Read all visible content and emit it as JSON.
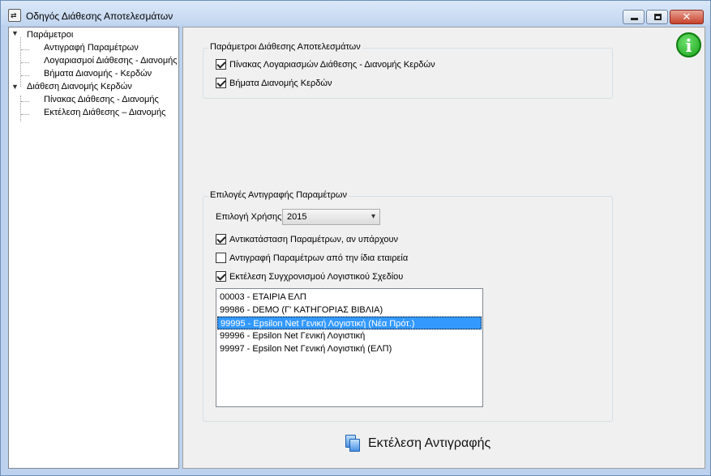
{
  "window": {
    "title": "Οδηγός Διάθεσης Αποτελεσμάτων",
    "app_icon": "arrows-icon"
  },
  "tree": {
    "nodes": [
      {
        "label": "Παράμετροι",
        "level": 0,
        "expanded": true
      },
      {
        "label": "Αντιγραφή Παραμέτρων",
        "level": 1
      },
      {
        "label": "Λογαριασμοί Διάθεσης - Διανομής",
        "level": 1
      },
      {
        "label": "Βήματα Διανομής - Κερδών",
        "level": 1
      },
      {
        "label": "Διάθεση Διανομής Κερδών",
        "level": 0,
        "expanded": true
      },
      {
        "label": "Πίνακας Διάθεσης - Διανομής",
        "level": 1
      },
      {
        "label": "Εκτέλεση Διάθεσης – Διανομής",
        "level": 1
      }
    ]
  },
  "params_group": {
    "title": "Παράμετροι Διάθεσης Αποτελεσμάτων",
    "checkboxes": [
      {
        "label": "Πίνακας Λογαριασμών Διάθεσης - Διανομής Κερδών",
        "checked": true
      },
      {
        "label": "Βήματα Διανομής Κερδών",
        "checked": true
      }
    ]
  },
  "copy_group": {
    "title": "Επιλογές Αντιγραφής Παραμέτρων",
    "year_label": "Επιλογή Χρήσης",
    "year_value": "2015",
    "checkboxes": [
      {
        "label": "Αντικατάσταση Παραμέτρων, αν υπάρχουν",
        "checked": true
      },
      {
        "label": "Αντιγραφή Παραμέτρων από την ίδια εταιρεία",
        "checked": false
      },
      {
        "label": "Εκτέλεση Συγχρονισμού Λογιστικού Σχεδίου",
        "checked": true
      }
    ],
    "companies": [
      {
        "label": "00003 - ΕΤΑΙΡΙΑ ΕΛΠ",
        "selected": false
      },
      {
        "label": "99986 - DEMO  (Γ' ΚΑΤΗΓΟΡΙΑΣ ΒΙΒΛΙΑ)",
        "selected": false
      },
      {
        "label": "99995 - Epsilon Net Γενική Λογιστική (Νέα Πρότ.)",
        "selected": true
      },
      {
        "label": "99996 - Epsilon Net Γενική Λογιστική",
        "selected": false
      },
      {
        "label": "99997 - Epsilon Net Γενική Λογιστική (ΕΛΠ)",
        "selected": false
      }
    ]
  },
  "run_button": {
    "label": "Εκτέλεση Αντιγραφής",
    "icon": "copy-icon"
  },
  "colors": {
    "selection": "#3399ff",
    "info_icon": "#1aa51a",
    "window_frame": "#bcd2ee"
  }
}
